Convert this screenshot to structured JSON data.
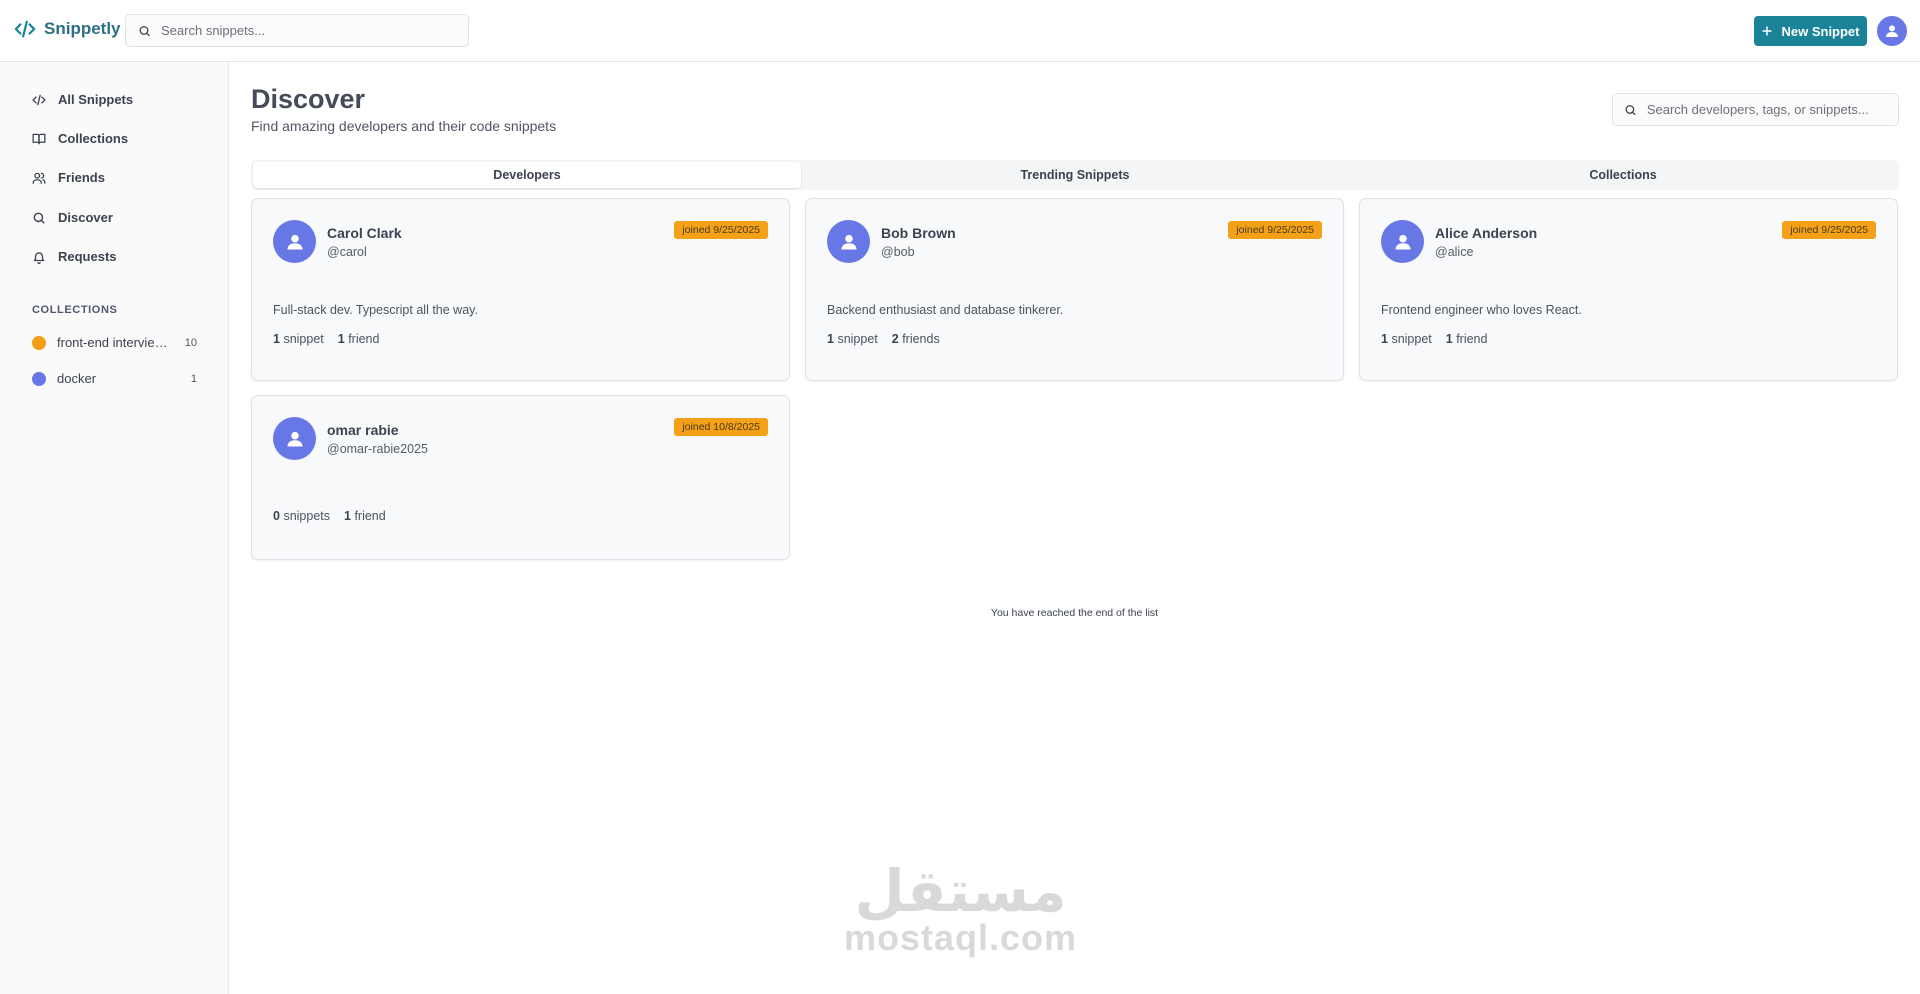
{
  "app": {
    "name": "Snippetly",
    "search_placeholder": "Search snippets...",
    "new_snippet_label": "New Snippet",
    "accent": "#1a8398"
  },
  "sidebar": {
    "items": [
      {
        "label": "All Snippets",
        "icon": "code-icon"
      },
      {
        "label": "Collections",
        "icon": "book-icon"
      },
      {
        "label": "Friends",
        "icon": "users-icon"
      },
      {
        "label": "Discover",
        "icon": "search-icon"
      },
      {
        "label": "Requests",
        "icon": "bell-icon"
      }
    ],
    "collections_title": "COLLECTIONS",
    "collections": [
      {
        "name": "front-end interview questions",
        "count": "10",
        "color": "#f29e18"
      },
      {
        "name": "docker",
        "count": "1",
        "color": "#6778e6"
      }
    ]
  },
  "main": {
    "title": "Discover",
    "subtitle": "Find amazing developers and their code snippets",
    "search_placeholder": "Search developers, tags, or snippets...",
    "tabs": [
      {
        "label": "Developers",
        "active": true
      },
      {
        "label": "Trending Snippets",
        "active": false
      },
      {
        "label": "Collections",
        "active": false
      }
    ],
    "developers": [
      {
        "name": "Carol Clark",
        "handle": "@carol",
        "joined": "joined 9/25/2025",
        "bio": "Full-stack dev. Typescript all the way.",
        "snippets_num": "1",
        "snippets_label": "snippet",
        "friends_num": "1",
        "friends_label": "friend"
      },
      {
        "name": "Bob Brown",
        "handle": "@bob",
        "joined": "joined 9/25/2025",
        "bio": "Backend enthusiast and database tinkerer.",
        "snippets_num": "1",
        "snippets_label": "snippet",
        "friends_num": "2",
        "friends_label": "friends"
      },
      {
        "name": "Alice Anderson",
        "handle": "@alice",
        "joined": "joined 9/25/2025",
        "bio": "Frontend engineer who loves React.",
        "snippets_num": "1",
        "snippets_label": "snippet",
        "friends_num": "1",
        "friends_label": "friend"
      },
      {
        "name": "omar rabie",
        "handle": "@omar-rabie2025",
        "joined": "joined 10/8/2025",
        "bio": "",
        "snippets_num": "0",
        "snippets_label": "snippets",
        "friends_num": "1",
        "friends_label": "friend"
      }
    ],
    "end_message": "You have reached the end of the list",
    "badge_color": "#f4a118"
  },
  "watermark": {
    "arabic": "مستقل",
    "latin": "mostaql.com"
  }
}
